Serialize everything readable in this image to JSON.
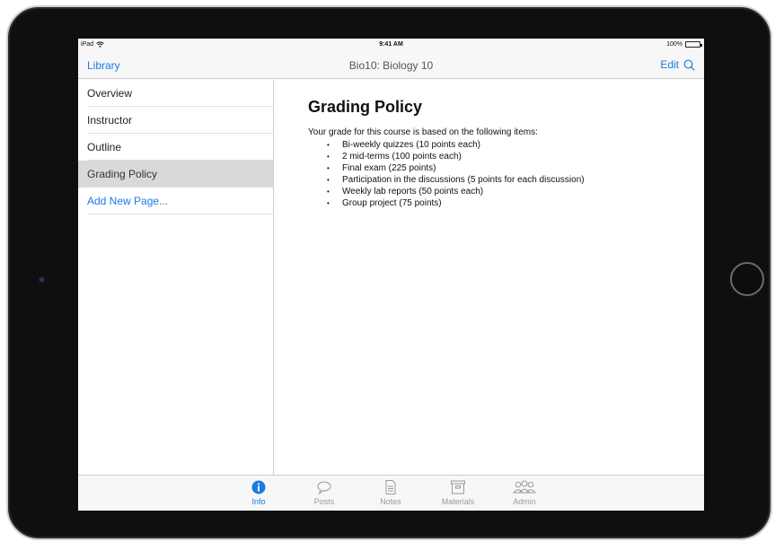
{
  "statusbar": {
    "device": "iPad",
    "time": "9:41 AM",
    "battery": "100%"
  },
  "navbar": {
    "back_label": "Library",
    "title": "Bio10: Biology 10",
    "edit_label": "Edit"
  },
  "sidebar": {
    "items": [
      {
        "label": "Overview"
      },
      {
        "label": "Instructor"
      },
      {
        "label": "Outline"
      },
      {
        "label": "Grading Policy"
      },
      {
        "label": "Add New Page..."
      }
    ]
  },
  "content": {
    "title": "Grading Policy",
    "intro": "Your grade for this course is based on the following items:",
    "items": [
      "Bi-weekly quizzes (10 points each)",
      "2 mid-terms (100 points each)",
      "Final exam (225 points)",
      "Participation in the discussions (5 points for each discussion)",
      "Weekly lab reports (50 points each)",
      "Group project (75 points)"
    ]
  },
  "tabbar": {
    "tabs": [
      {
        "label": "Info"
      },
      {
        "label": "Posts"
      },
      {
        "label": "Notes"
      },
      {
        "label": "Materials"
      },
      {
        "label": "Admin"
      }
    ]
  },
  "colors": {
    "accent": "#1a7ae6",
    "selected_row": "#d9d9d9",
    "bar_background": "#f7f7f7",
    "inactive_tab": "#9a9a9a"
  }
}
